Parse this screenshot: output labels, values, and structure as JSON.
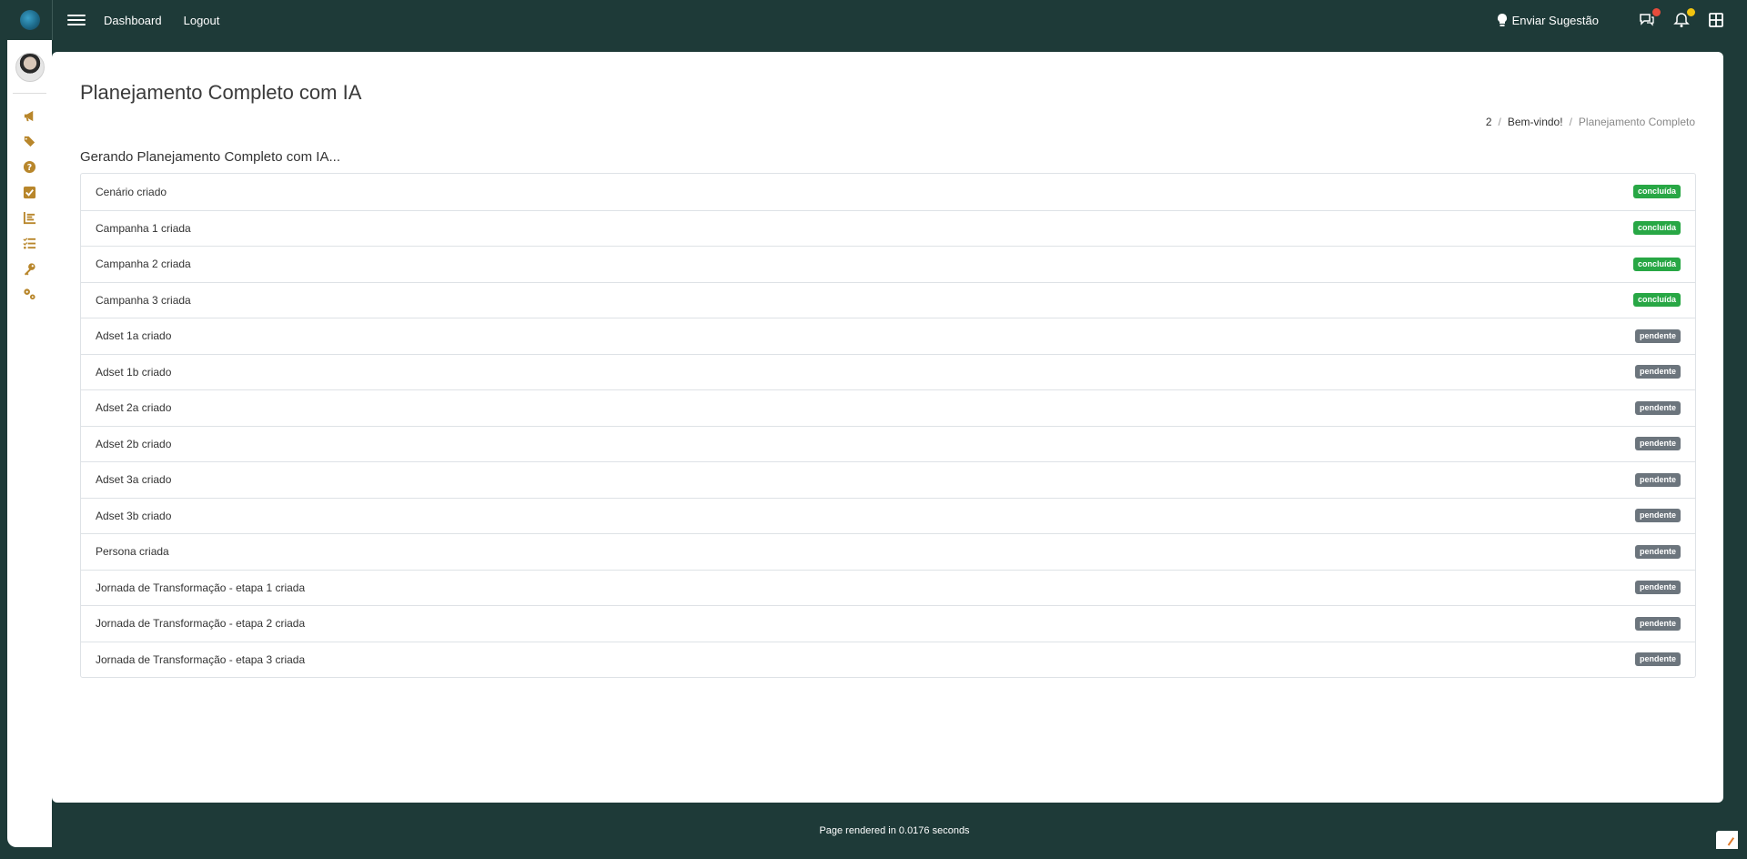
{
  "topbar": {
    "nav": [
      "Dashboard",
      "Logout"
    ],
    "suggest_label": "Enviar Sugestão",
    "colors": {
      "chat_badge": "#e74c3c",
      "bell_badge": "#f1c40f"
    }
  },
  "sidebar": {
    "icons": [
      "megaphone-icon",
      "tags-icon",
      "question-icon",
      "checkbox-icon",
      "chart-icon",
      "list-check-icon",
      "key-icon",
      "cogs-icon"
    ]
  },
  "page": {
    "title": "Planejamento Completo com IA",
    "breadcrumb": [
      "2",
      "Bem-vindo!",
      "Planejamento Completo"
    ],
    "section_title": "Gerando Planejamento Completo com IA..."
  },
  "tasks": [
    {
      "label": "Cenário criado",
      "status": "concluída"
    },
    {
      "label": "Campanha 1 criada",
      "status": "concluída"
    },
    {
      "label": "Campanha 2 criada",
      "status": "concluída"
    },
    {
      "label": "Campanha 3 criada",
      "status": "concluída"
    },
    {
      "label": "Adset 1a criado",
      "status": "pendente"
    },
    {
      "label": "Adset 1b criado",
      "status": "pendente"
    },
    {
      "label": "Adset 2a criado",
      "status": "pendente"
    },
    {
      "label": "Adset 2b criado",
      "status": "pendente"
    },
    {
      "label": "Adset 3a criado",
      "status": "pendente"
    },
    {
      "label": "Adset 3b criado",
      "status": "pendente"
    },
    {
      "label": "Persona criada",
      "status": "pendente"
    },
    {
      "label": "Jornada de Transformação - etapa 1 criada",
      "status": "pendente"
    },
    {
      "label": "Jornada de Transformação - etapa 2 criada",
      "status": "pendente"
    },
    {
      "label": "Jornada de Transformação - etapa 3 criada",
      "status": "pendente"
    }
  ],
  "status_colors": {
    "concluída": "#28a745",
    "pendente": "#6c757d"
  },
  "footer": {
    "text": "Page rendered in 0.0176 seconds"
  }
}
